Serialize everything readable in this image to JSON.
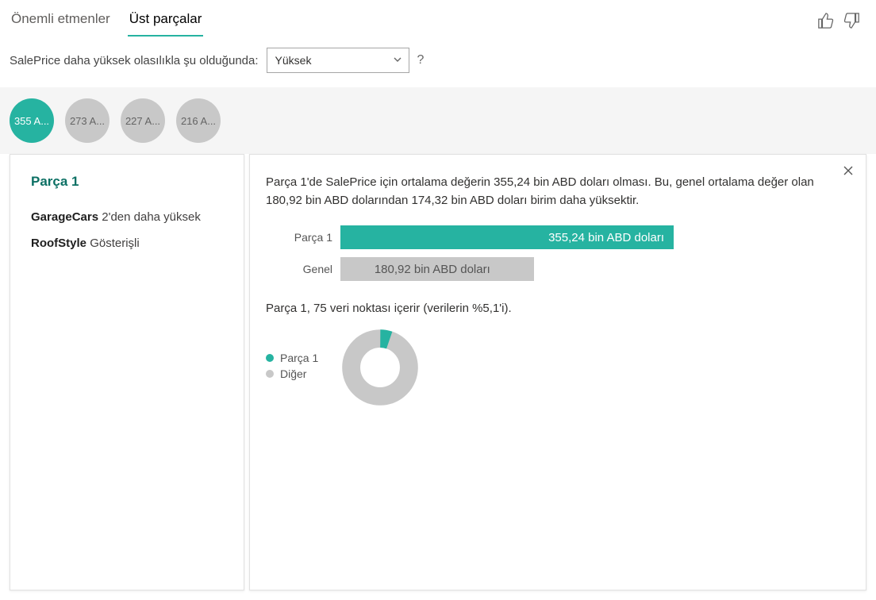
{
  "tabs": {
    "key_influencers": "Önemli etmenler",
    "top_segments": "Üst parçalar"
  },
  "prompt": {
    "text": "SalePrice daha yüksek olasılıkla şu olduğunda:",
    "selected": "Yüksek",
    "help": "?"
  },
  "bubbles": [
    "355 A...",
    "273 A...",
    "227 A...",
    "216 A..."
  ],
  "left_panel": {
    "title": "Parça 1",
    "conditions": [
      {
        "feature": "GarageCars",
        "desc": "2'den daha yüksek"
      },
      {
        "feature": "RoofStyle",
        "desc": "Gösterişli"
      }
    ]
  },
  "right_panel": {
    "description": "Parça 1'de SalePrice için ortalama değerin 355,24 bin ABD doları olması. Bu, genel ortalama değer olan 180,92 bin ABD dolarından 174,32 bin ABD doları birim daha yüksektir.",
    "bars": {
      "seg_label": "Parça 1",
      "seg_value": "355,24 bin ABD doları",
      "overall_label": "Genel",
      "overall_value": "180,92 bin ABD doları"
    },
    "donut_text": "Parça 1, 75 veri noktası içerir (verilerin %5,1'i).",
    "legend": {
      "primary": "Parça 1",
      "secondary": "Diğer"
    }
  },
  "chart_data": [
    {
      "type": "bar",
      "title": "Segment vs Overall average SalePrice",
      "categories": [
        "Parça 1",
        "Genel"
      ],
      "values": [
        355.24,
        180.92
      ],
      "unit": "bin ABD doları",
      "xlabel": "",
      "ylabel": ""
    },
    {
      "type": "pie",
      "title": "Segment share of data points",
      "series": [
        {
          "name": "Parça 1",
          "value": 5.1
        },
        {
          "name": "Diğer",
          "value": 94.9
        }
      ],
      "unit": "%",
      "count_in_segment": 75
    }
  ]
}
